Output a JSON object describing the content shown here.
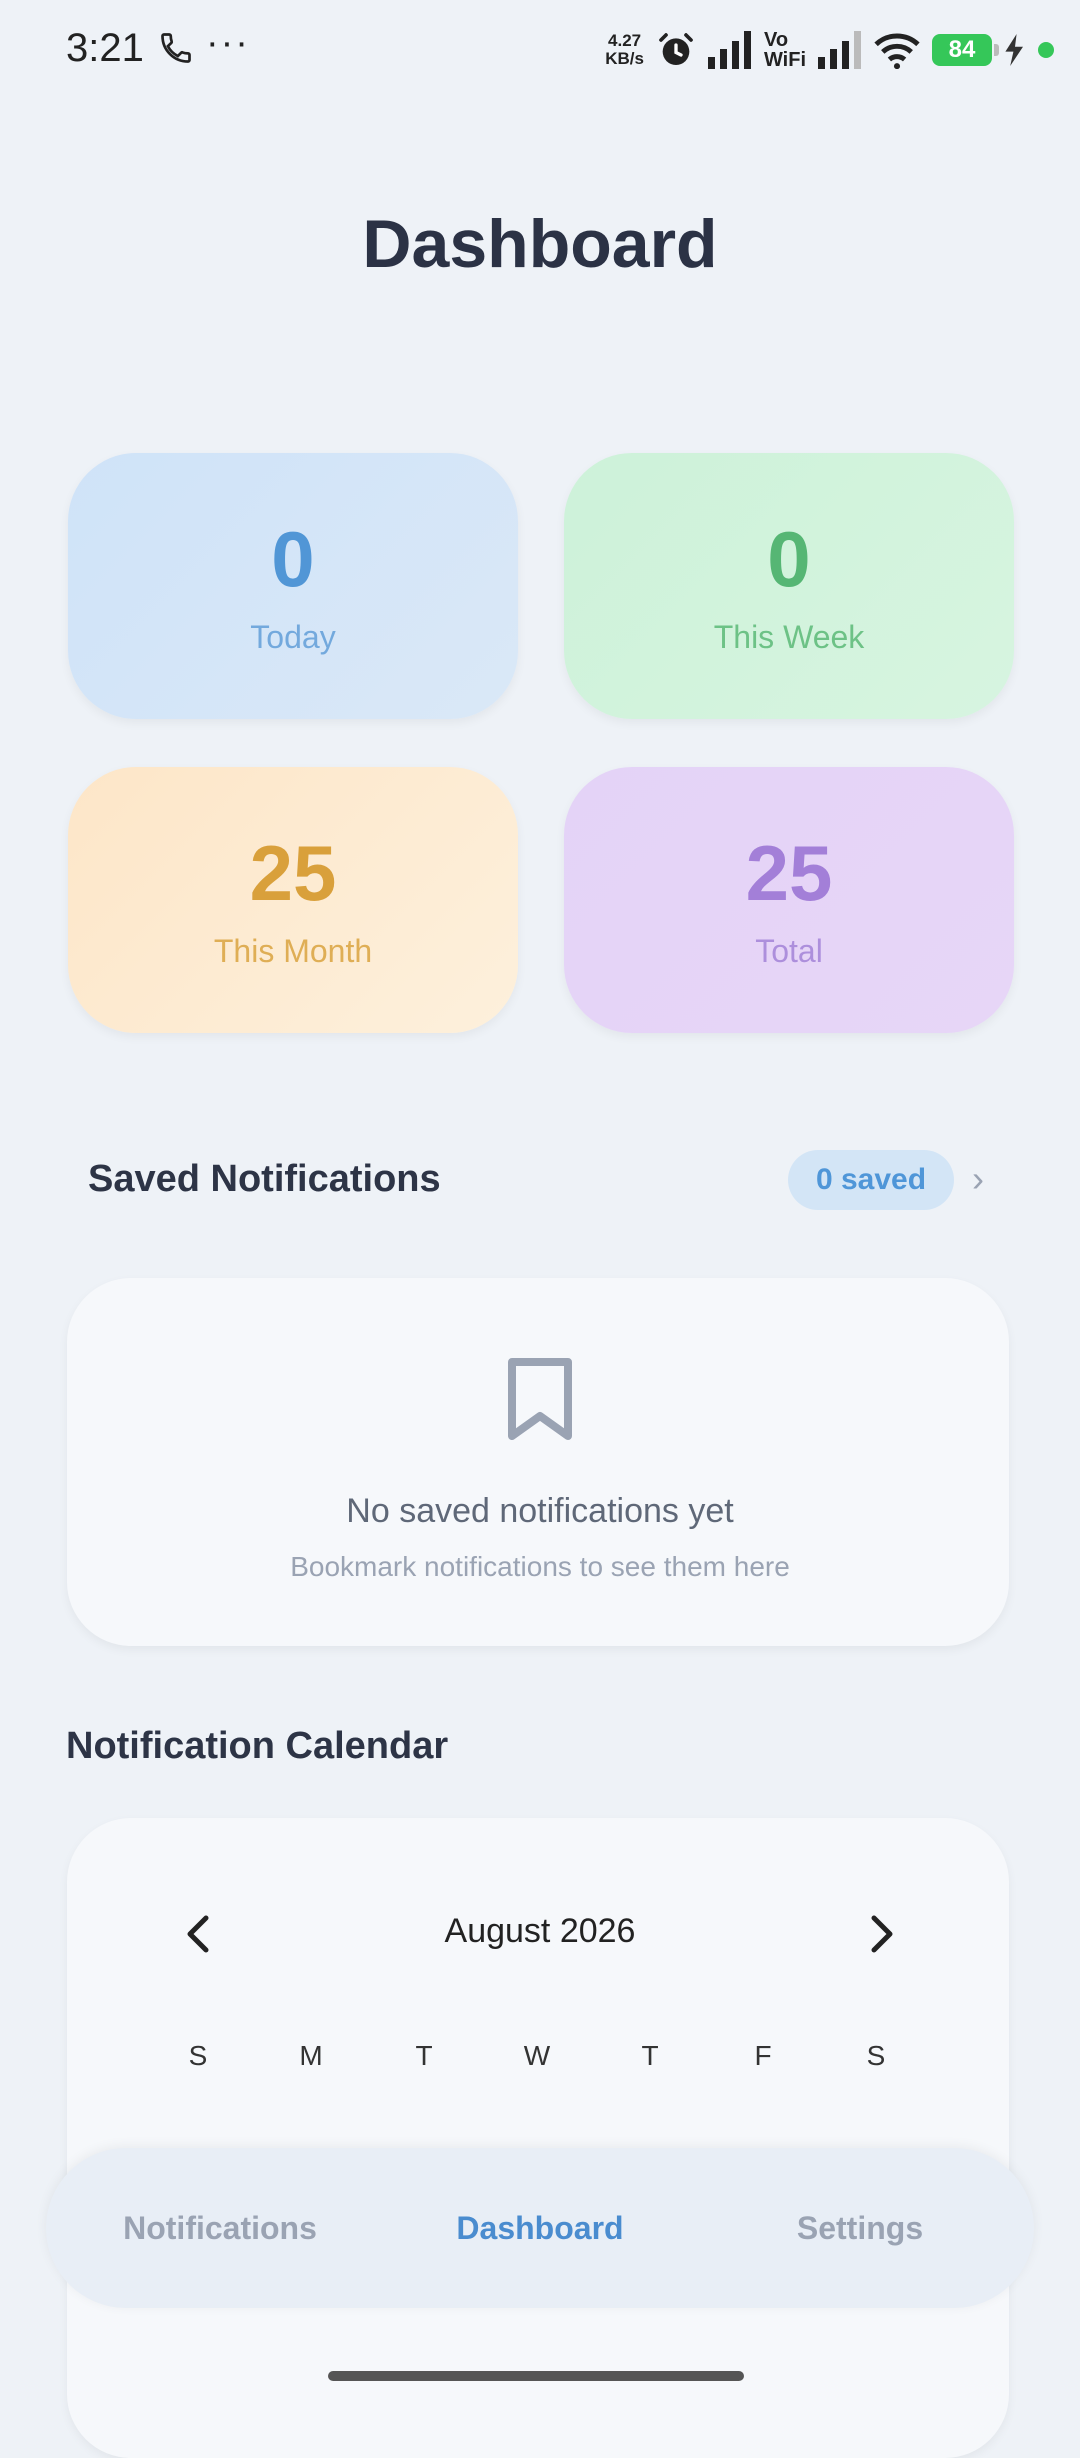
{
  "status_bar": {
    "time": "3:21",
    "more": "···",
    "speed_value": "4.27",
    "speed_unit": "KB/s",
    "vo": "Vo",
    "wifi": "WiFi",
    "battery": "84"
  },
  "page": {
    "title": "Dashboard"
  },
  "stats": {
    "today": {
      "value": "0",
      "label": "Today"
    },
    "week": {
      "value": "0",
      "label": "This Week"
    },
    "month": {
      "value": "25",
      "label": "This Month"
    },
    "total": {
      "value": "25",
      "label": "Total"
    }
  },
  "saved": {
    "title": "Saved Notifications",
    "badge": "0 saved",
    "empty_title": "No saved notifications yet",
    "empty_subtitle": "Bookmark notifications to see them here"
  },
  "calendar": {
    "title": "Notification Calendar",
    "month": "August 2026",
    "weekdays": [
      "S",
      "M",
      "T",
      "W",
      "T",
      "F",
      "S"
    ]
  },
  "nav": {
    "notifications": "Notifications",
    "dashboard": "Dashboard",
    "settings": "Settings",
    "active": "Dashboard"
  },
  "colors": {
    "accent": "#4a8ccf",
    "today": "#5196d6",
    "week": "#56b674",
    "month": "#d9a03b",
    "total": "#a37fd8"
  }
}
